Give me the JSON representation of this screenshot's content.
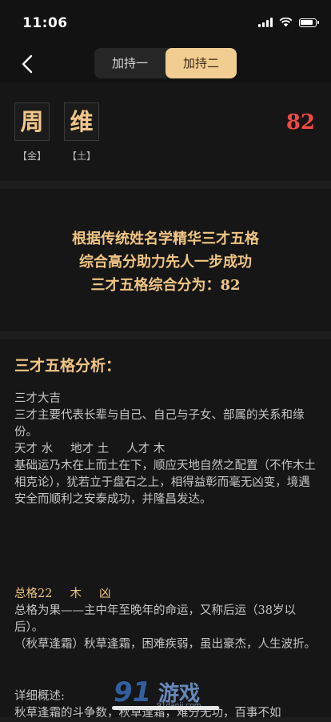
{
  "status": {
    "time": "11:06"
  },
  "nav": {
    "back_label": "‹",
    "tabs": [
      {
        "label": "加持一"
      },
      {
        "label": "加持二"
      }
    ]
  },
  "name": {
    "chars": [
      {
        "char": "周",
        "element": "【金】"
      },
      {
        "char": "维",
        "element": "【土】"
      }
    ],
    "score": "82"
  },
  "summary": {
    "lines": [
      "根据传统姓名学精华三才五格",
      "综合高分助力先人一步成功",
      "三才五格综合分为：82"
    ]
  },
  "analysis": {
    "title": "三才五格分析：",
    "sancai_result": "三才大吉",
    "sancai_desc": "三才主要代表长辈与自己、自己与子女、部属的关系和缘份。",
    "tiancai": "天才 水",
    "dicai": "地才 土",
    "rencai": "人才 木",
    "basis_desc": "基础运乃木在上而土在下，顺应天地自然之配置（不作木土相克论），犹若立于盘石之上，相得益彰而毫无凶变，境遇安全而顺利之安泰成功，并隆昌发达。",
    "zongge_label": "总格22",
    "zongge_element": "木",
    "zongge_luck": "凶",
    "zongge_desc": "总格为果——主中年至晚年的命运，又称后运（38岁以后）。",
    "zongge_poem": "（秋草逢霜）秋草逢霜，困难疾弱，虽出豪杰，人生波折。",
    "detail_label": "详细概述:",
    "detail_text": "秋草逢霜的斗争数，秋草逢霜，难分无功，百事不如"
  },
  "watermark": {
    "logo_text": "游戏",
    "url_text": "91danji.com"
  },
  "colors": {
    "accent": "#f0c584",
    "tab_active": "#f2cd91",
    "score": "#ef4a43",
    "background": "#1d1d1d",
    "card": "#161616"
  }
}
